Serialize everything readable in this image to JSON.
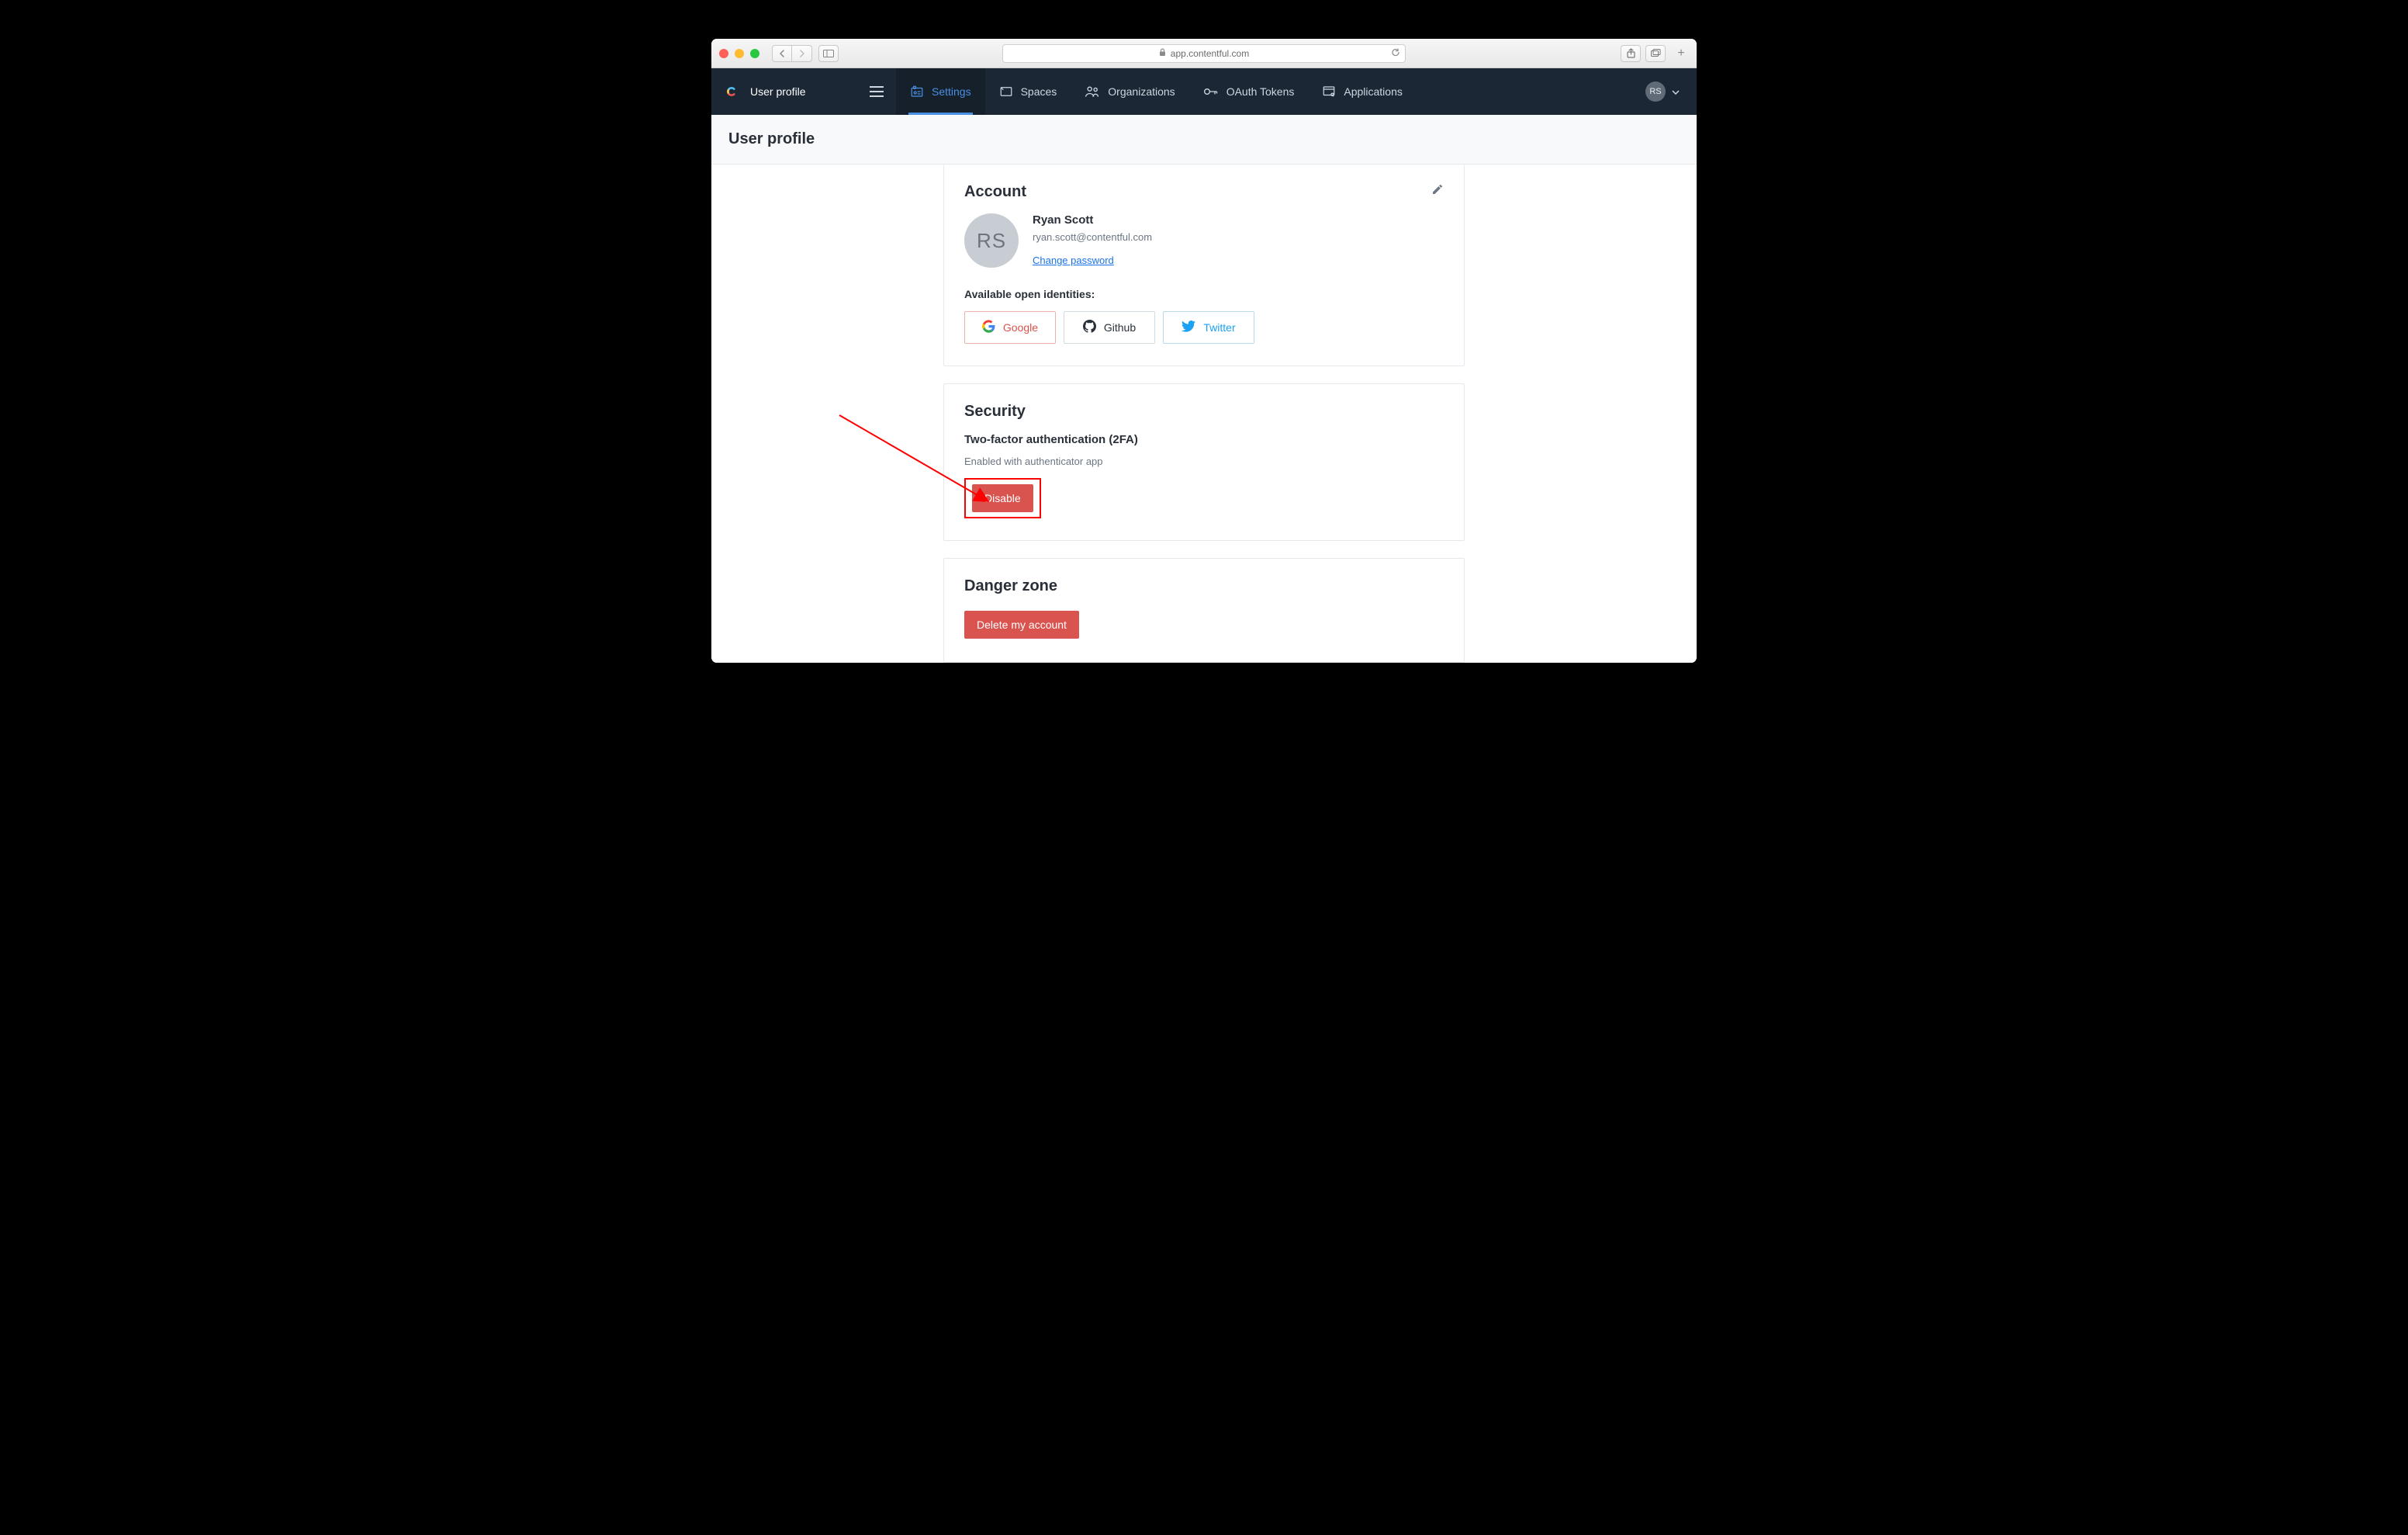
{
  "browser": {
    "url_host": "app.contentful.com"
  },
  "nav": {
    "brand_title": "User profile",
    "tabs": {
      "settings": "Settings",
      "spaces": "Spaces",
      "organizations": "Organizations",
      "oauth": "OAuth Tokens",
      "applications": "Applications"
    },
    "avatar_initials": "RS"
  },
  "page": {
    "title": "User profile"
  },
  "account": {
    "heading": "Account",
    "avatar_initials": "RS",
    "name": "Ryan Scott",
    "email": "ryan.scott@contentful.com",
    "change_password": "Change password",
    "identities_label": "Available open identities:",
    "identities": {
      "google": "Google",
      "github": "Github",
      "twitter": "Twitter"
    }
  },
  "security": {
    "heading": "Security",
    "subheading": "Two-factor authentication (2FA)",
    "status": "Enabled with authenticator app",
    "disable_label": "Disable"
  },
  "danger": {
    "heading": "Danger zone",
    "delete_label": "Delete my account"
  }
}
